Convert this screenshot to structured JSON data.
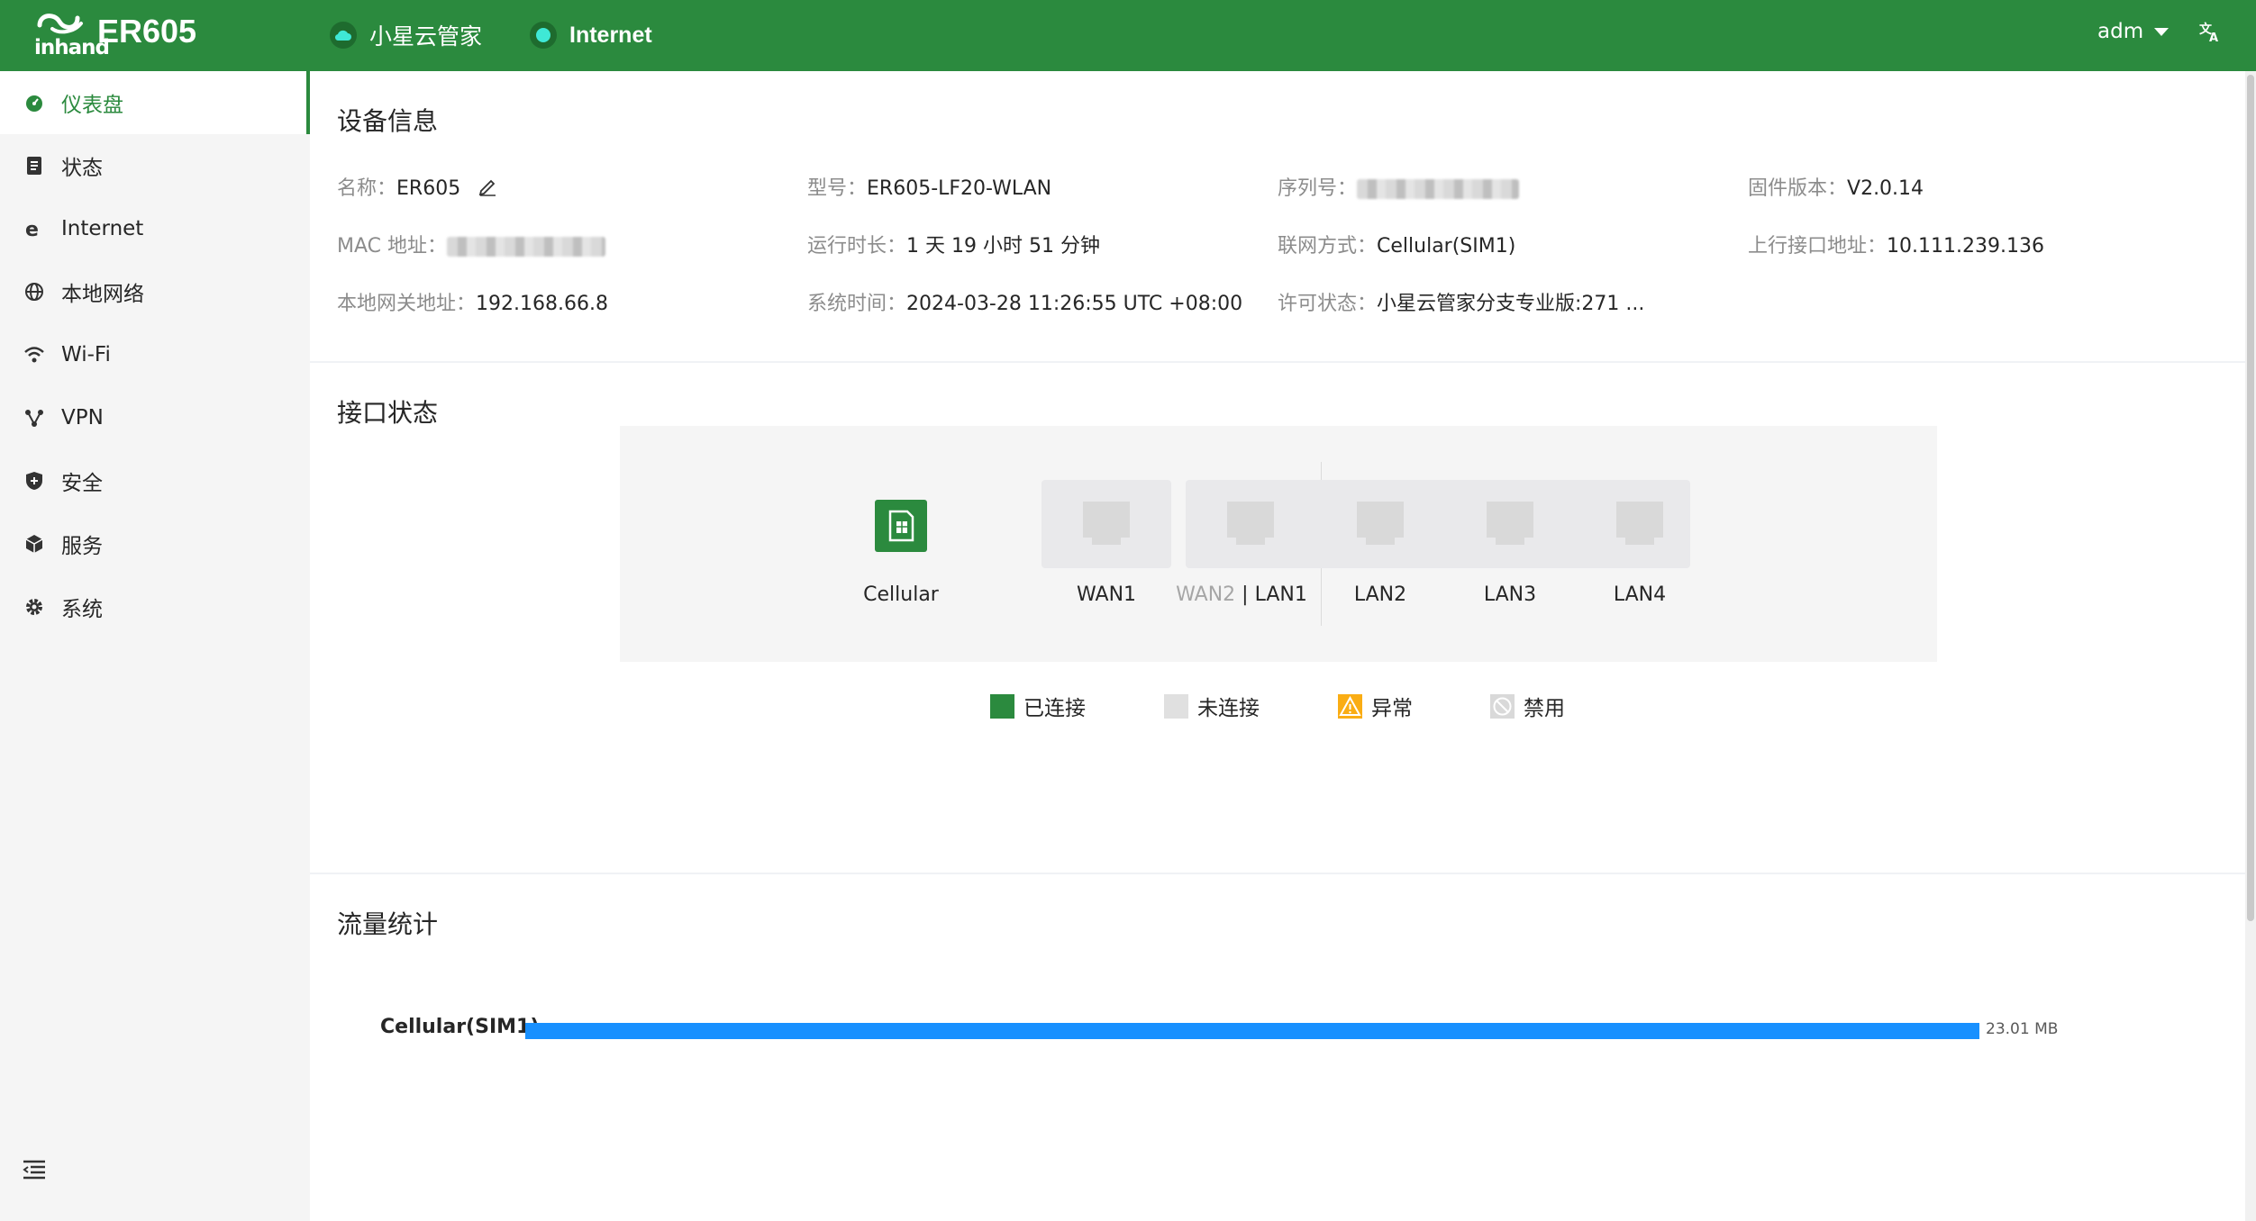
{
  "header": {
    "logo_text": "inhand",
    "product": "ER605",
    "cloud_label": "小星云管家",
    "internet_label": "Internet",
    "user": "adm",
    "lang_icon": "translate-icon"
  },
  "sidebar": {
    "items": [
      {
        "label": "仪表盘",
        "icon": "dashboard-icon"
      },
      {
        "label": "状态",
        "icon": "status-icon"
      },
      {
        "label": "Internet",
        "icon": "internet-icon"
      },
      {
        "label": "本地网络",
        "icon": "globe-icon"
      },
      {
        "label": "Wi-Fi",
        "icon": "wifi-icon"
      },
      {
        "label": "VPN",
        "icon": "vpn-icon"
      },
      {
        "label": "安全",
        "icon": "shield-icon"
      },
      {
        "label": "服务",
        "icon": "cube-icon"
      },
      {
        "label": "系统",
        "icon": "gear-icon"
      }
    ],
    "active": "仪表盘"
  },
  "device_info": {
    "title": "设备信息",
    "name_label": "名称：",
    "name": "ER605",
    "model_label": "型号：",
    "model": "ER605-LF20-WLAN",
    "serial_label": "序列号：",
    "firmware_label": "固件版本：",
    "firmware": "V2.0.14",
    "mac_label": "MAC 地址：",
    "uptime_label": "运行时长：",
    "uptime": "1 天 19 小时 51 分钟",
    "link_label": "联网方式：",
    "link": "Cellular(SIM1)",
    "uplink_ip_label": "上行接口地址：",
    "uplink_ip": "10.111.239.136",
    "gateway_label": "本地网关地址：",
    "gateway": "192.168.66.8",
    "systime_label": "系统时间：",
    "systime": "2024-03-28 11:26:55 UTC +08:00",
    "license_label": "许可状态：",
    "license": "小星云管家分支专业版:271 ..."
  },
  "interfaces": {
    "title": "接口状态",
    "cellular": "Cellular",
    "wan1": "WAN1",
    "wan2": "WAN2",
    "wan2_sep": " | ",
    "lan1": "LAN1",
    "lan2": "LAN2",
    "lan3": "LAN3",
    "lan4": "LAN4",
    "legend": {
      "connected": "已连接",
      "disconnected": "未连接",
      "abnormal": "异常",
      "disabled": "禁用"
    },
    "colors": {
      "connected": "#2b8a3e",
      "disconnected": "#e0e0e0",
      "abnormal": "#faad14",
      "disabled": "#d9d9d9"
    }
  },
  "traffic": {
    "title": "流量统计",
    "interface": "Cellular(SIM1)",
    "value": "23.01 MB",
    "bar_color": "#1890ff"
  }
}
